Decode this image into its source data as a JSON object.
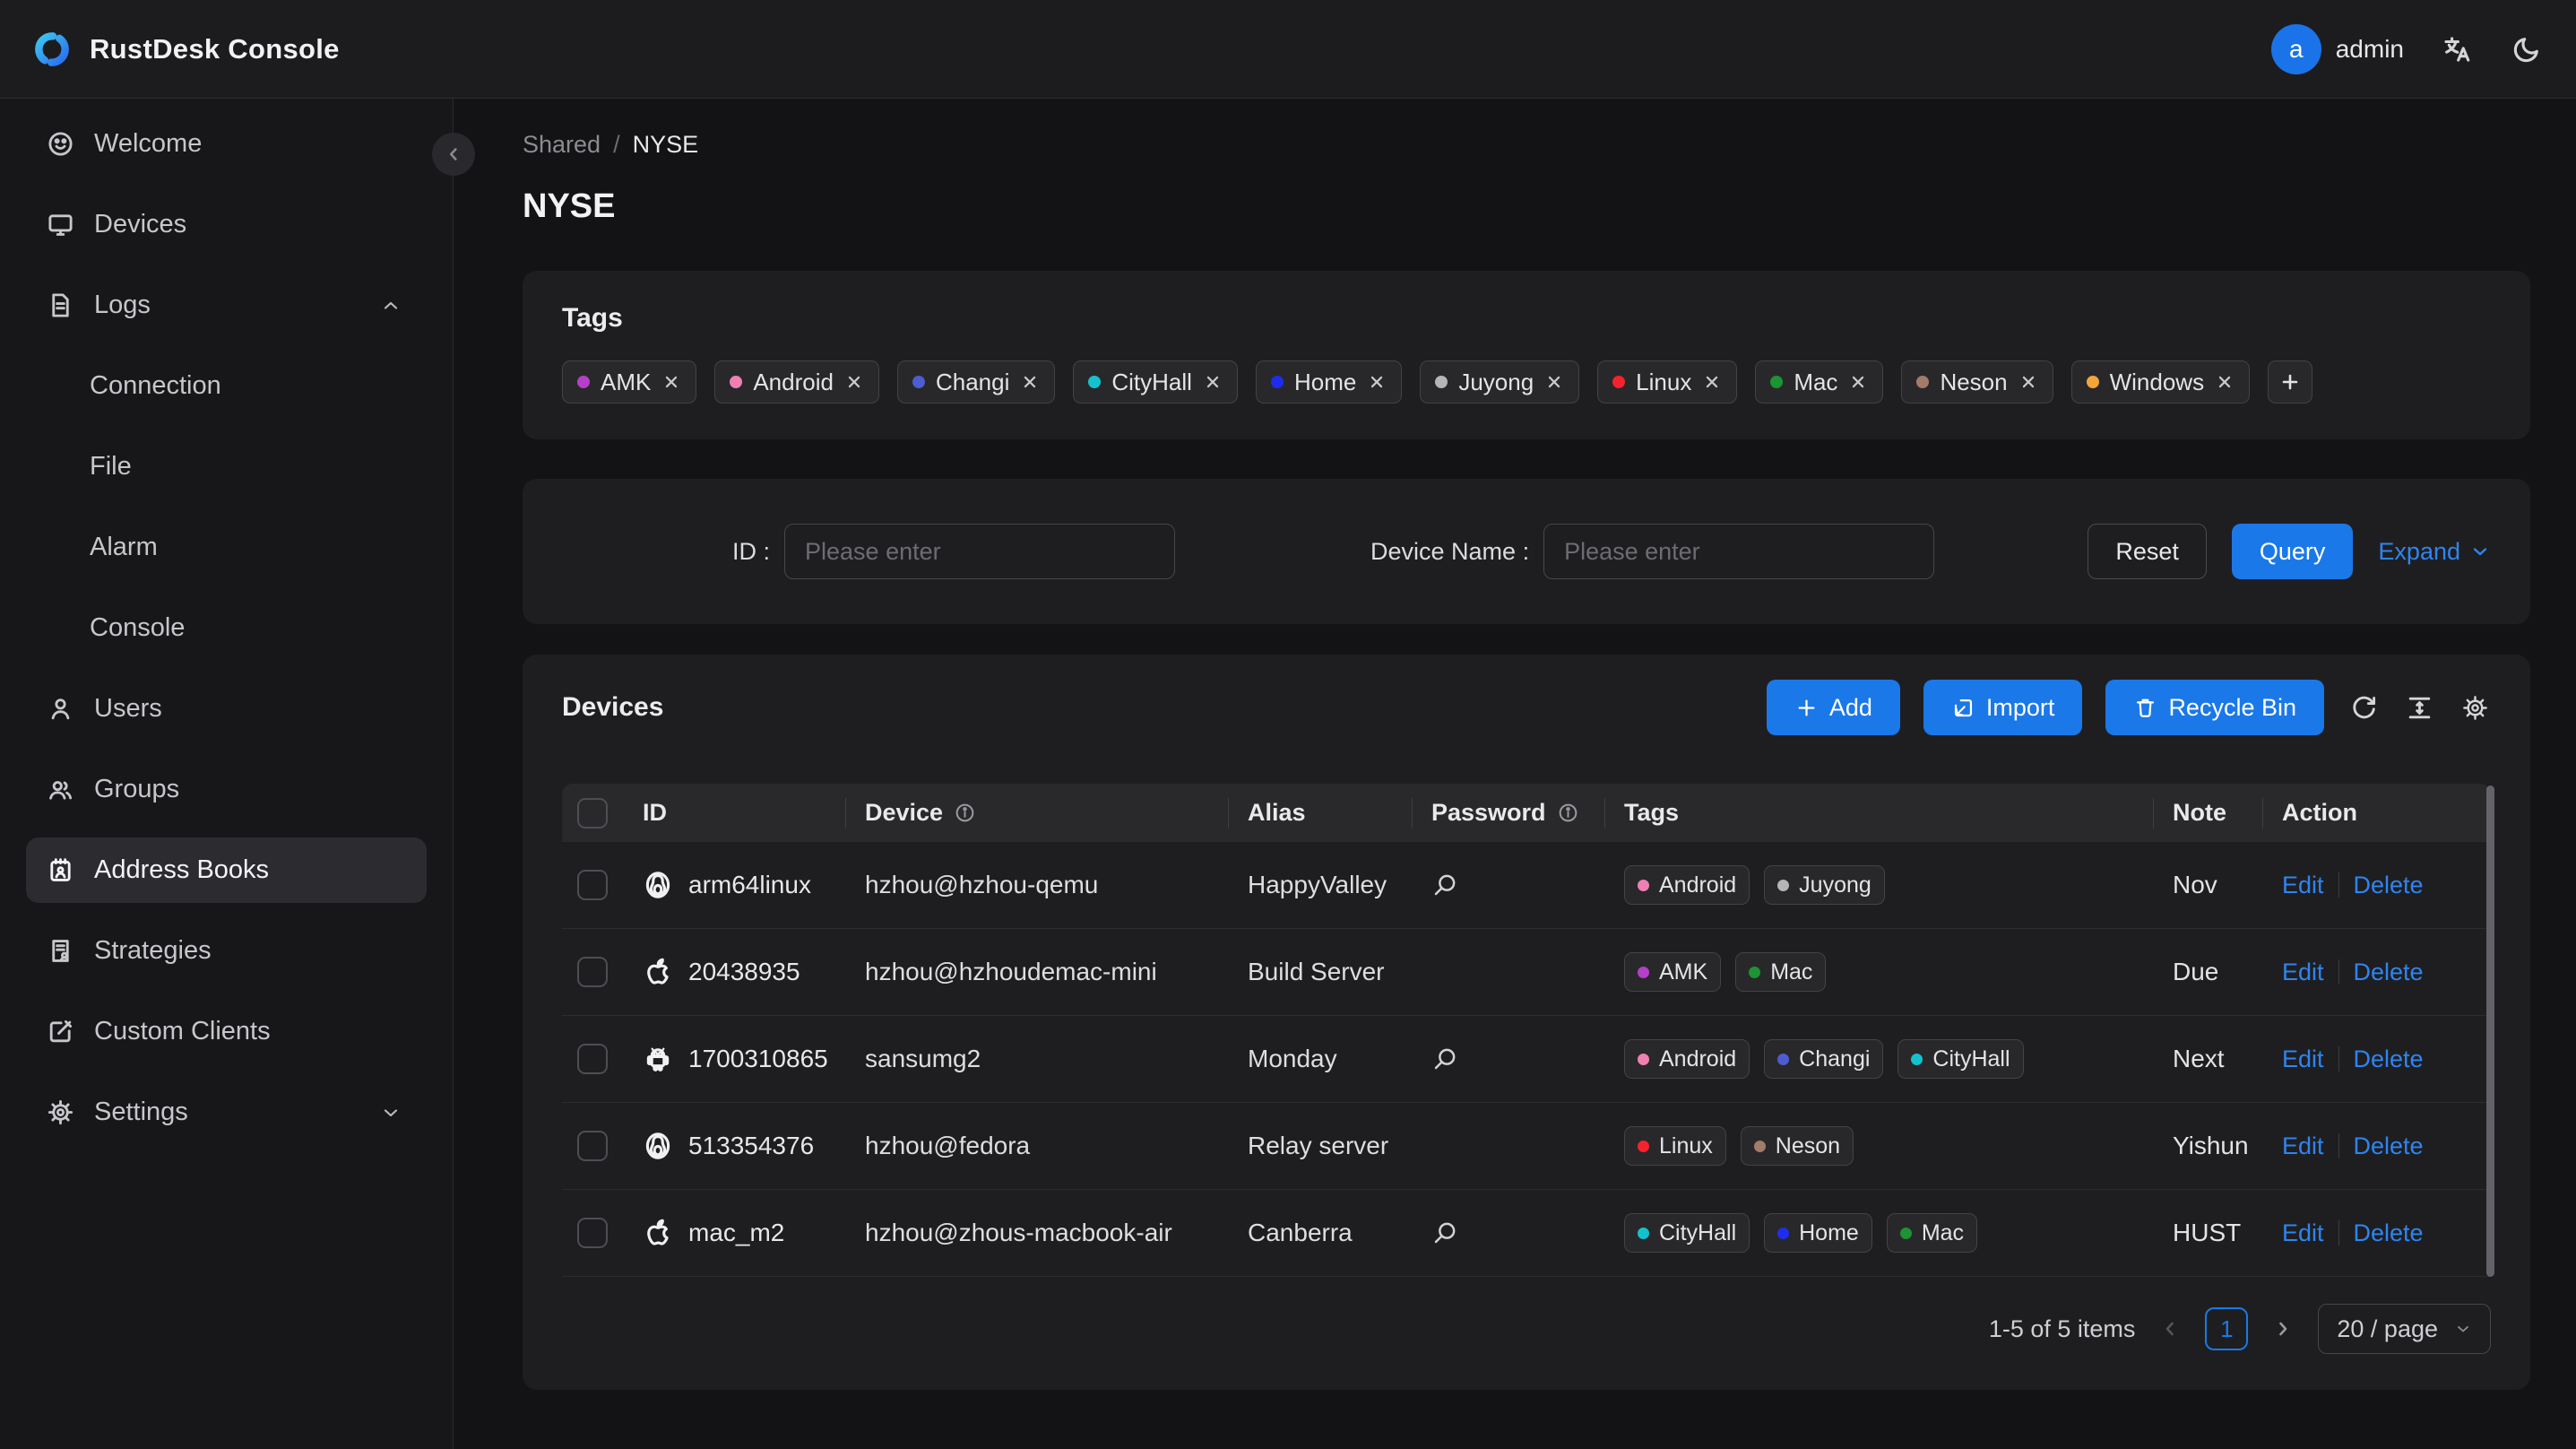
{
  "header": {
    "app_title": "RustDesk Console",
    "avatar_initial": "a",
    "username": "admin"
  },
  "sidebar": {
    "items": [
      {
        "label": "Welcome"
      },
      {
        "label": "Devices"
      },
      {
        "label": "Logs"
      },
      {
        "label": "Connection"
      },
      {
        "label": "File"
      },
      {
        "label": "Alarm"
      },
      {
        "label": "Console"
      },
      {
        "label": "Users"
      },
      {
        "label": "Groups"
      },
      {
        "label": "Address Books"
      },
      {
        "label": "Strategies"
      },
      {
        "label": "Custom Clients"
      },
      {
        "label": "Settings"
      }
    ],
    "selected": "Address Books"
  },
  "breadcrumb": {
    "parent": "Shared",
    "separator": "/",
    "current": "NYSE"
  },
  "page_title": "NYSE",
  "tags_card": {
    "title": "Tags",
    "tags": [
      {
        "label": "AMK",
        "color": "#b43fc8"
      },
      {
        "label": "Android",
        "color": "#f07fb2"
      },
      {
        "label": "Changi",
        "color": "#4d5cd0"
      },
      {
        "label": "CityHall",
        "color": "#13c2cd"
      },
      {
        "label": "Home",
        "color": "#1f2cf0"
      },
      {
        "label": "Juyong",
        "color": "#b5b5b8"
      },
      {
        "label": "Linux",
        "color": "#f5222d"
      },
      {
        "label": "Mac",
        "color": "#1c9433"
      },
      {
        "label": "Neson",
        "color": "#a37b6a"
      },
      {
        "label": "Windows",
        "color": "#f3a53a"
      }
    ]
  },
  "filter": {
    "id_label": "ID :",
    "id_placeholder": "Please enter",
    "device_name_label": "Device Name :",
    "device_name_placeholder": "Please enter",
    "reset_label": "Reset",
    "query_label": "Query",
    "expand_label": "Expand"
  },
  "devices": {
    "title": "Devices",
    "add_label": "Add",
    "import_label": "Import",
    "recycle_label": "Recycle Bin",
    "columns": {
      "id": "ID",
      "device": "Device",
      "alias": "Alias",
      "password": "Password",
      "tags": "Tags",
      "note": "Note",
      "action": "Action"
    },
    "edit_label": "Edit",
    "delete_label": "Delete",
    "rows": [
      {
        "id": "arm64linux",
        "os_icon": "linux-icon",
        "device": "hzhou@hzhou-qemu",
        "alias": "HappyValley",
        "has_password_search": true,
        "tags": [
          {
            "label": "Android",
            "color": "#f07fb2"
          },
          {
            "label": "Juyong",
            "color": "#b5b5b8"
          }
        ],
        "note": "Nov"
      },
      {
        "id": "20438935",
        "os_icon": "apple-icon",
        "device": "hzhou@hzhoudemac-mini",
        "alias": "Build Server",
        "has_password_search": false,
        "tags": [
          {
            "label": "AMK",
            "color": "#b43fc8"
          },
          {
            "label": "Mac",
            "color": "#1c9433"
          }
        ],
        "note": "Due"
      },
      {
        "id": "1700310865",
        "os_icon": "android-icon",
        "device": "sansumg2",
        "alias": "Monday",
        "has_password_search": true,
        "tags": [
          {
            "label": "Android",
            "color": "#f07fb2"
          },
          {
            "label": "Changi",
            "color": "#4d5cd0"
          },
          {
            "label": "CityHall",
            "color": "#13c2cd"
          }
        ],
        "note": "Next"
      },
      {
        "id": "513354376",
        "os_icon": "linux-icon",
        "device": "hzhou@fedora",
        "alias": "Relay server",
        "has_password_search": false,
        "tags": [
          {
            "label": "Linux",
            "color": "#f5222d"
          },
          {
            "label": "Neson",
            "color": "#a37b6a"
          }
        ],
        "note": "Yishun"
      },
      {
        "id": "mac_m2",
        "os_icon": "apple-icon",
        "device": "hzhou@zhous-macbook-air",
        "alias": "Canberra",
        "has_password_search": true,
        "tags": [
          {
            "label": "CityHall",
            "color": "#13c2cd"
          },
          {
            "label": "Home",
            "color": "#1f2cf0"
          },
          {
            "label": "Mac",
            "color": "#1c9433"
          }
        ],
        "note": "HUST"
      }
    ]
  },
  "pagination": {
    "summary": "1-5 of 5 items",
    "page": "1",
    "page_size": "20 / page"
  },
  "colors": {
    "primary_blue": "#1a78e8",
    "link_blue": "#2e85f0",
    "card_bg": "#1e1e21",
    "page_bg": "#131316"
  }
}
